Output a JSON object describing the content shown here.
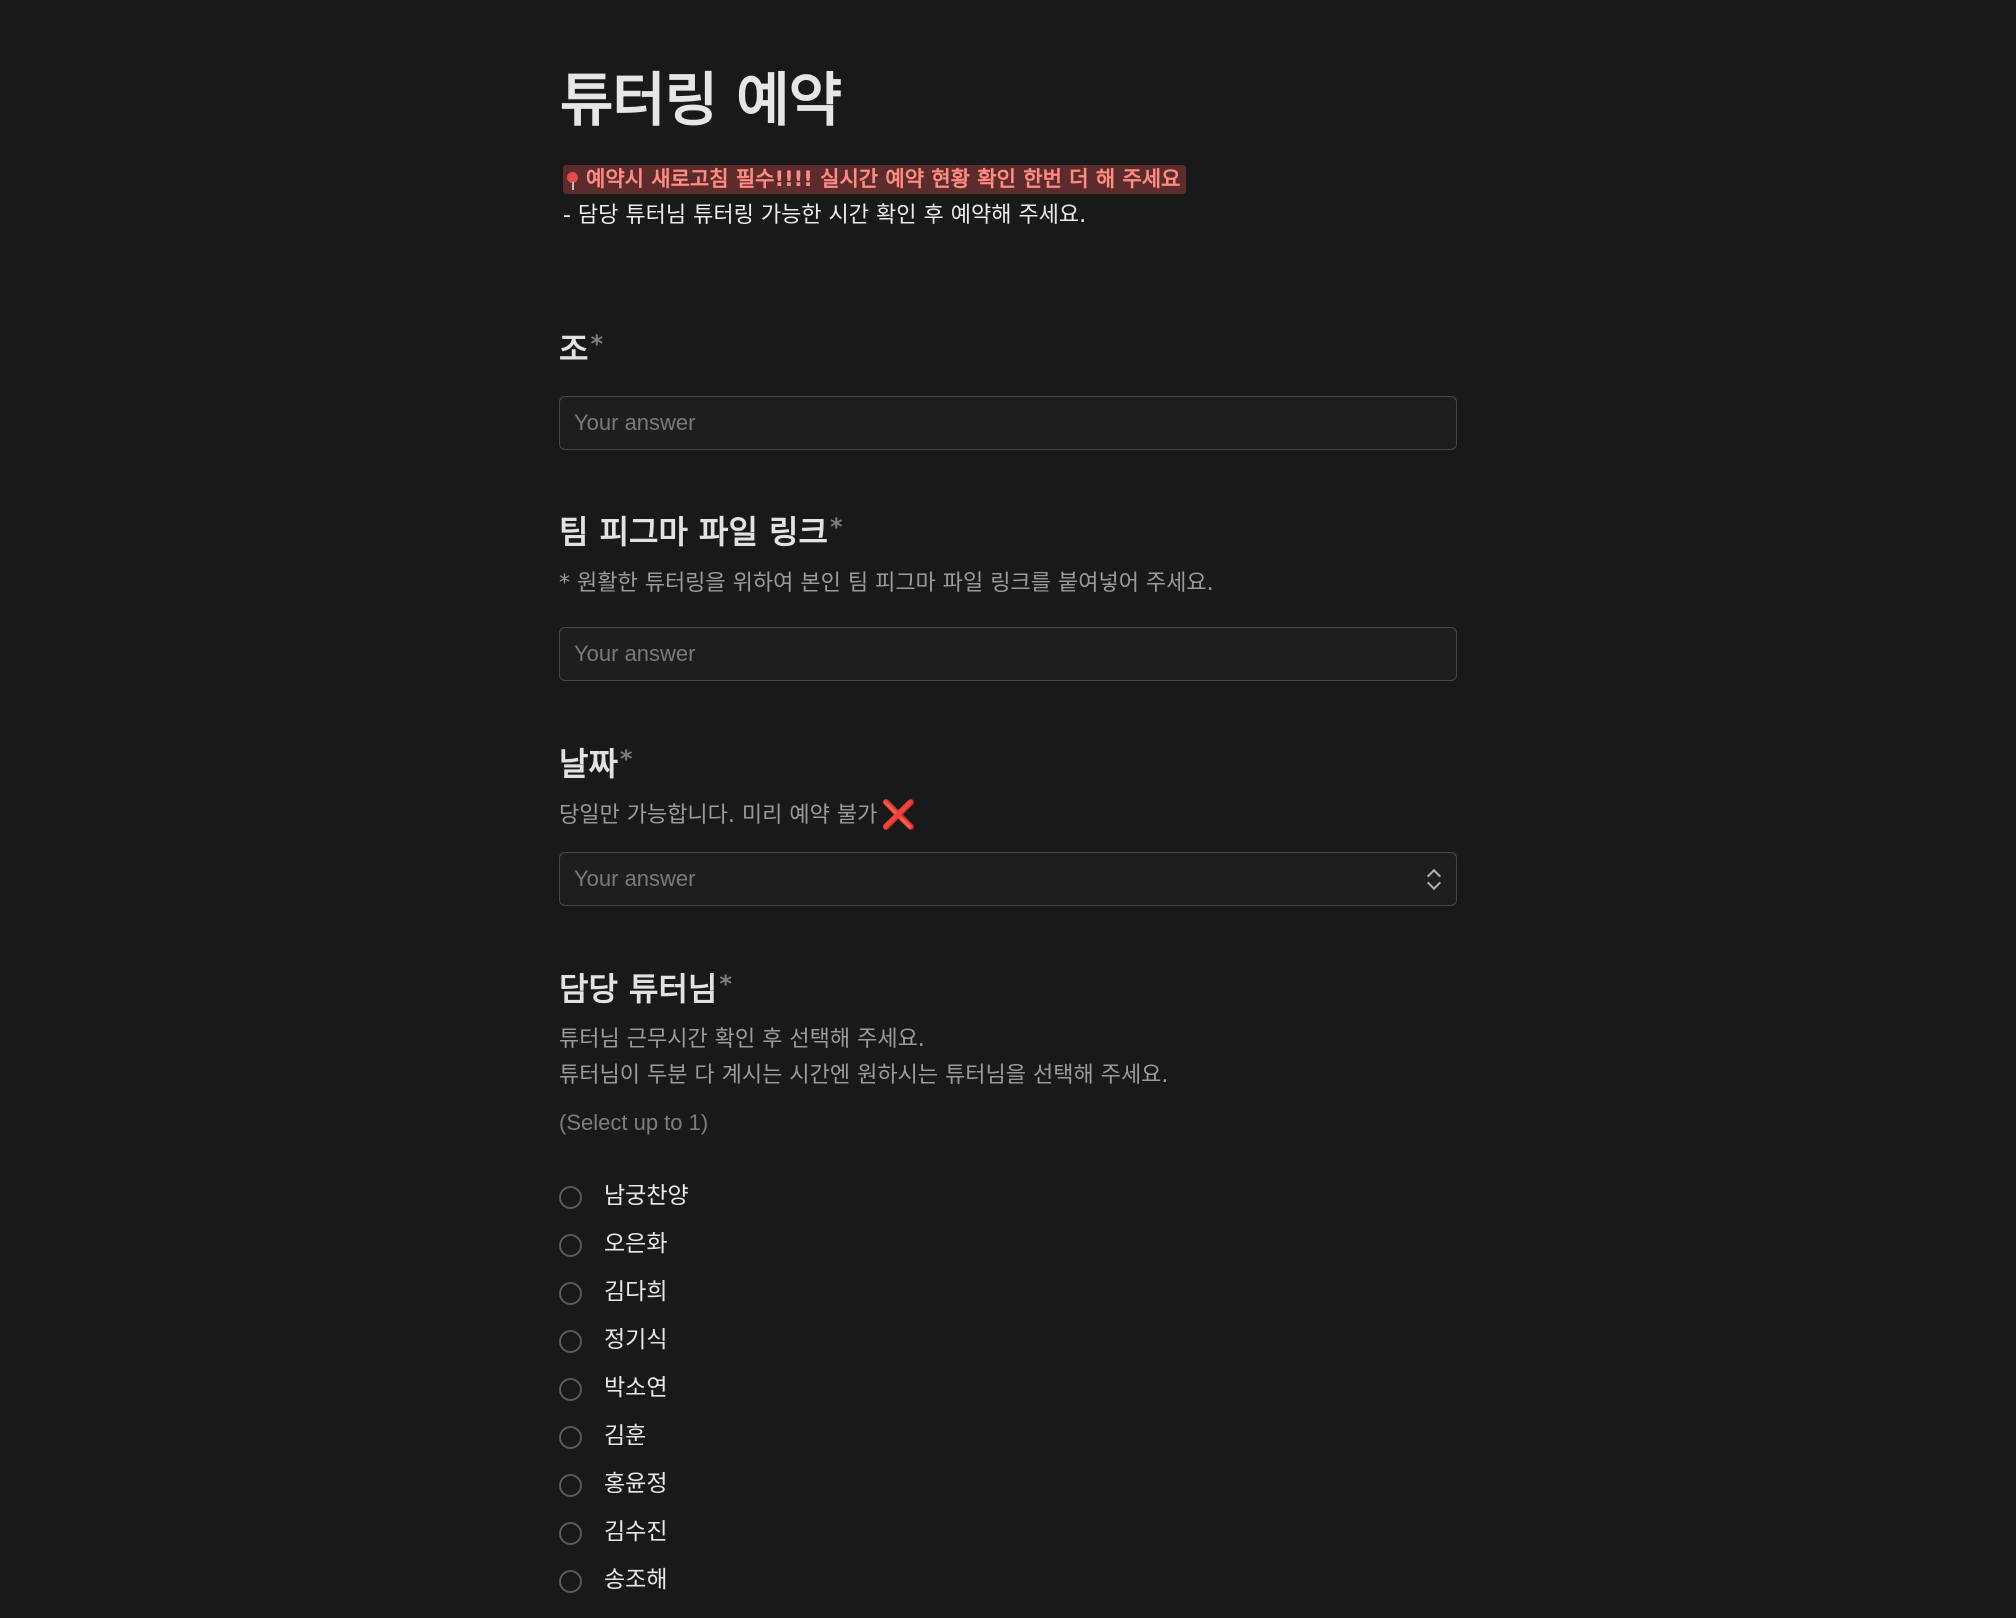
{
  "page": {
    "title": "튜터링 예약",
    "notice": "예약시 새로고침 필수!!!! 실시간 예약 현황 확인 한번 더 해 주세요",
    "subnote": "- 담당 튜터님 튜터링 가능한 시간 확인 후 예약해 주세요."
  },
  "questions": {
    "team": {
      "label": "조",
      "required_mark": "*",
      "placeholder": "Your answer"
    },
    "figma": {
      "label": "팀 피그마 파일 링크",
      "required_mark": "*",
      "description": "* 원활한 튜터링을 위하여 본인 팀 피그마 파일 링크를 붙여넣어 주세요.",
      "placeholder": "Your answer"
    },
    "date": {
      "label": "날짜",
      "required_mark": "*",
      "description": "당일만 가능합니다. 미리 예약 불가",
      "description_icon": "❌",
      "placeholder": "Your answer"
    },
    "tutor": {
      "label": "담당 튜터님",
      "required_mark": "*",
      "description_line1": "튜터님 근무시간 확인 후 선택해 주세요.",
      "description_line2": "튜터님이 두분 다 계시는 시간엔 원하시는 튜터님을 선택해 주세요.",
      "select_limit": "(Select up to 1)",
      "options": [
        "남궁찬양",
        "오은화",
        "김다희",
        "정기식",
        "박소연",
        "김훈",
        "홍윤정",
        "김수진",
        "송조해"
      ]
    }
  }
}
